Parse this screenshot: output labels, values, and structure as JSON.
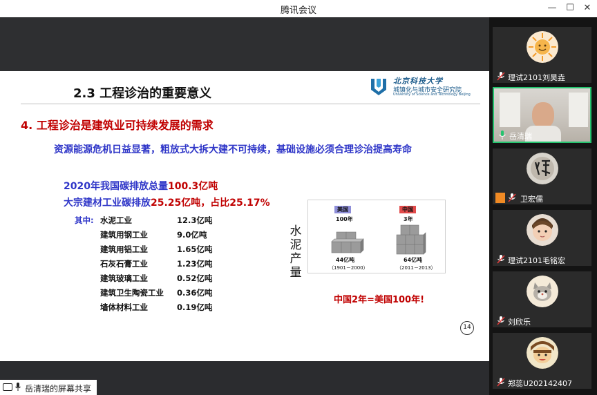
{
  "window": {
    "title": "腾讯会议",
    "minimize": "—",
    "maximize": "☐",
    "close": "✕"
  },
  "slide": {
    "title": "2.3  工程诊治的重要意义",
    "logo": {
      "line1": "北京科技大学",
      "line2": "城镇化与城市安全研究院",
      "line3": "University of Science and Technology Beijing"
    },
    "heading": "4. 工程诊治是建筑业可持续发展的需求",
    "subheading": "资源能源危机日益显著，粗放式大拆大建不可持续，基础设施必须合理诊治提高寿命",
    "emissions": {
      "total_prefix": "2020年我国碳排放总量",
      "total_value": "100.3亿吨",
      "bulk_prefix": "大宗建材工业碳排放",
      "bulk_value": "25.25亿吨，占比25.17%"
    },
    "breakdown_prefix": "其中:",
    "breakdown": [
      {
        "name": "水泥工业",
        "value": "12.3亿吨"
      },
      {
        "name": "建筑用钢工业",
        "value": "9.0亿吨"
      },
      {
        "name": "建筑用铝工业",
        "value": "1.65亿吨"
      },
      {
        "name": "石灰石膏工业",
        "value": "1.23亿吨"
      },
      {
        "name": "建筑玻璃工业",
        "value": "0.52亿吨"
      },
      {
        "name": "建筑卫生陶瓷工业",
        "value": "0.36亿吨"
      },
      {
        "name": "墙体材料工业",
        "value": "0.19亿吨"
      }
    ],
    "vertical_label": [
      "水",
      "泥",
      "产",
      "量"
    ],
    "figure": {
      "us": {
        "flag": "美国",
        "years": "100年",
        "amount": "44亿吨",
        "range": "（1901－2000）",
        "flag_color": "#8e8ed8"
      },
      "cn": {
        "flag": "中国",
        "years": "3年",
        "amount": "64亿吨",
        "range": "（2011－2013）",
        "flag_color": "#e24b4b"
      }
    },
    "comparison": "中国2年=美国100年!",
    "page_number": "14"
  },
  "share_status": "岳清瑞的屏幕共享",
  "participants": [
    {
      "name": "理试2101刘昊垚",
      "avatar": "sun-avatar",
      "muted": true
    },
    {
      "name": "岳清瑞",
      "avatar": "video-feed",
      "muted": false,
      "active": true
    },
    {
      "name": "卫宏儒",
      "avatar": "calligraphy-avatar",
      "muted": true
    },
    {
      "name": "理试2101毛铭宏",
      "avatar": "child-photo-avatar",
      "muted": true
    },
    {
      "name": "刘欣乐",
      "avatar": "cartoon-cat-avatar",
      "muted": true
    },
    {
      "name": "郑蕊U202142407",
      "avatar": "cartoon-face-avatar",
      "muted": true
    }
  ],
  "colors": {
    "accent_red": "#c00000",
    "accent_blue": "#2f36c8",
    "active_border": "#25c46f"
  }
}
